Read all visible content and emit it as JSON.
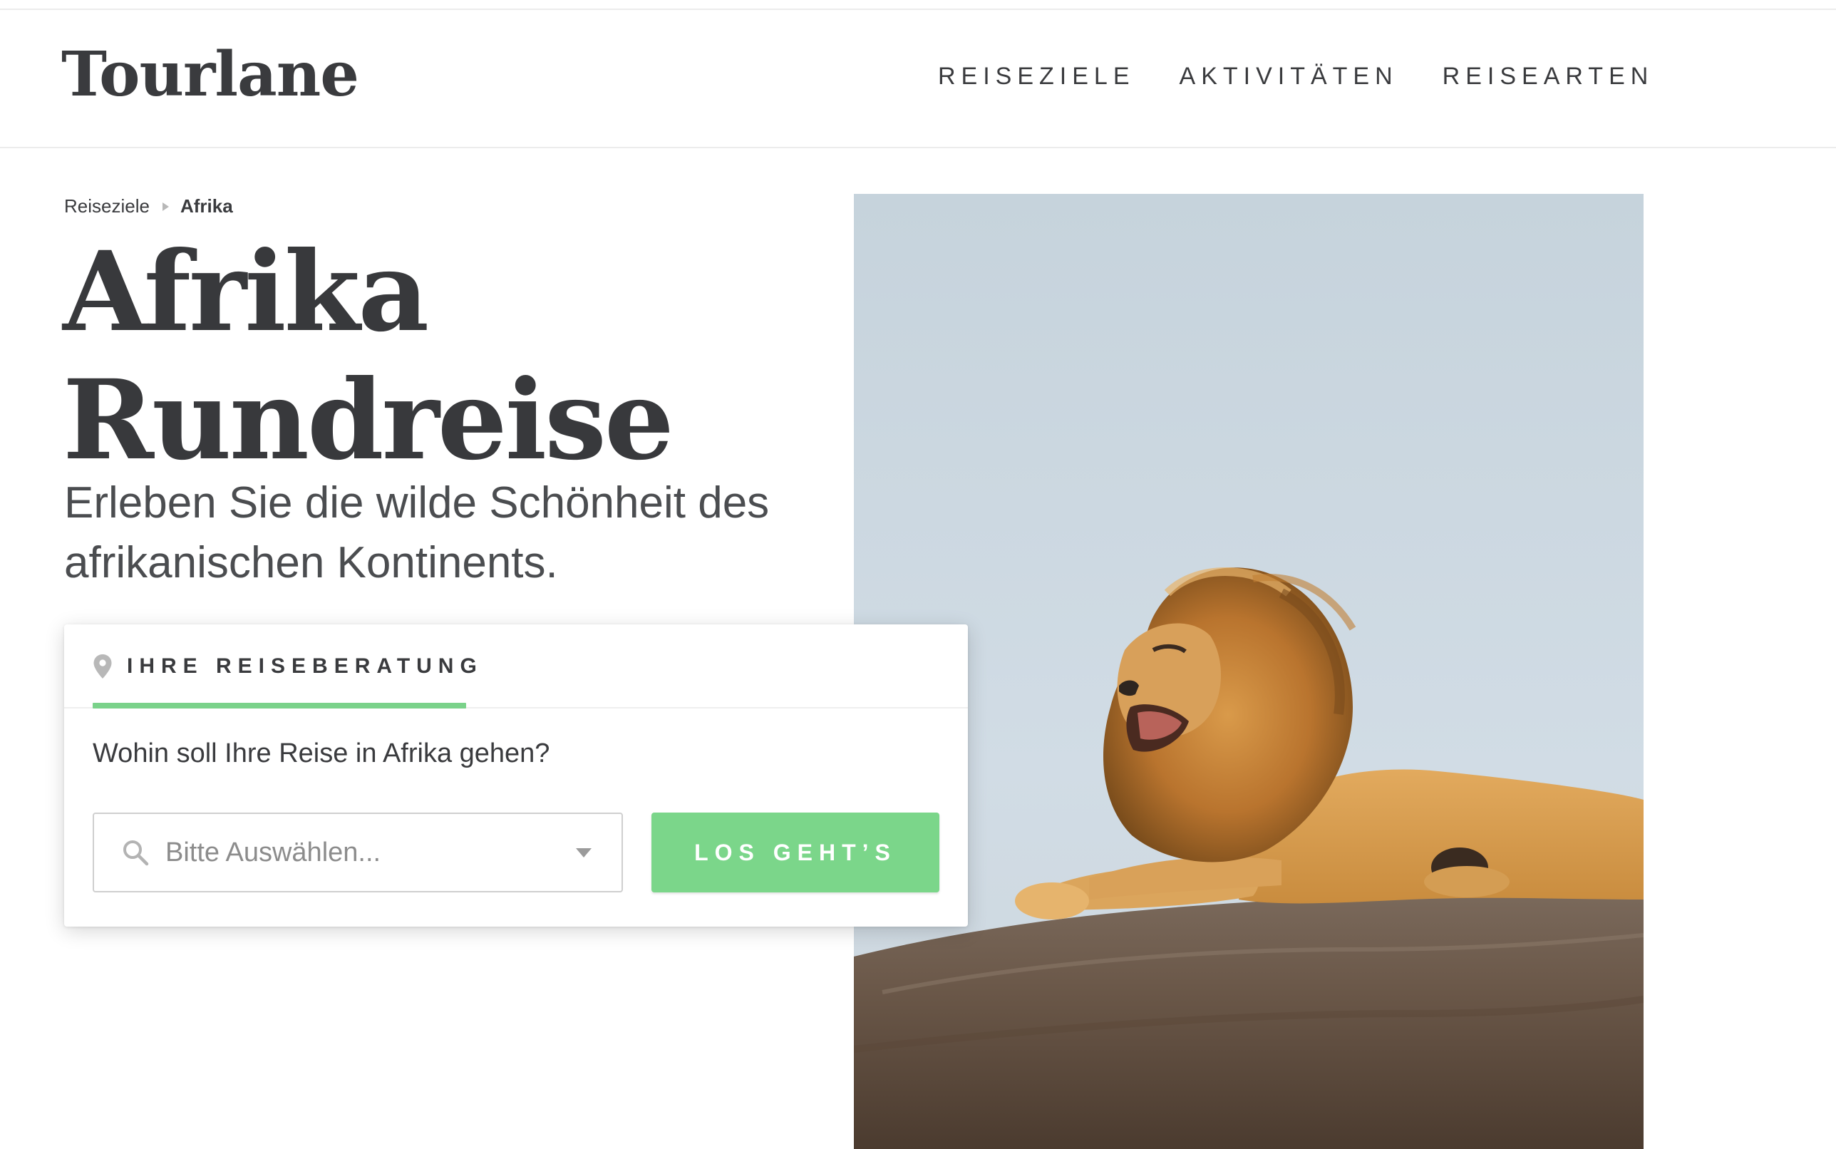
{
  "header": {
    "logo": "Tourlane",
    "nav": [
      "REISEZIELE",
      "AKTIVITÄTEN",
      "REISEARTEN"
    ]
  },
  "breadcrumb": {
    "items": [
      "Reiseziele",
      "Afrika"
    ]
  },
  "hero": {
    "title_line1": "Afrika",
    "title_line2": "Rundreise",
    "subtitle_line1": "Erleben Sie die wilde Schönheit des",
    "subtitle_line2": "afrikanischen Kontinents.",
    "image_subject": "lion resting on a rock under a pale sky"
  },
  "advice_card": {
    "tab_label": "IHRE REISEBERATUNG",
    "tab_icon": "location-pin-icon",
    "question": "Wohin soll Ihre Reise in Afrika gehen?",
    "select_placeholder": "Bitte Auswählen...",
    "button_label": "LOS GEHT’S"
  },
  "colors": {
    "text": "#3a3b3e",
    "accent_green": "#7bd68a",
    "divider": "#ececec"
  }
}
